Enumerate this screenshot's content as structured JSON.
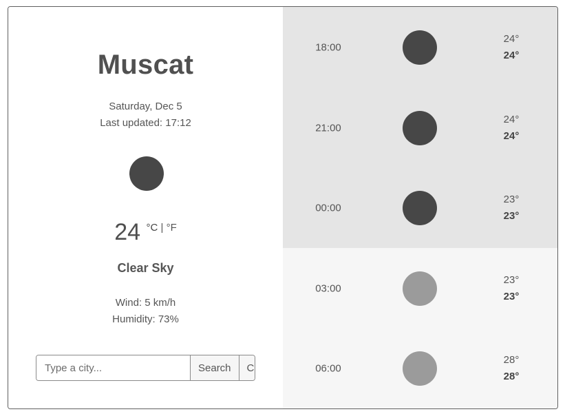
{
  "current": {
    "city": "Muscat",
    "date": "Saturday, Dec 5",
    "last_updated": "Last updated: 17:12",
    "icon": "moon-icon",
    "temperature": "24",
    "unit_celsius": "°C",
    "unit_separator": "|",
    "unit_fahrenheit": "°F",
    "description": "Clear Sky",
    "wind": "Wind: 5 km/h",
    "humidity": "Humidity: 73%"
  },
  "search": {
    "placeholder": "Type a city...",
    "value": "",
    "search_label": "Search",
    "current_label": "Current"
  },
  "forecast": [
    {
      "time": "18:00",
      "icon": "moon-icon",
      "temp_top": "24°",
      "temp_bottom": "24°"
    },
    {
      "time": "21:00",
      "icon": "moon-icon",
      "temp_top": "24°",
      "temp_bottom": "24°"
    },
    {
      "time": "00:00",
      "icon": "moon-icon",
      "temp_top": "23°",
      "temp_bottom": "23°"
    },
    {
      "time": "03:00",
      "icon": "sun-icon",
      "temp_top": "23°",
      "temp_bottom": "23°"
    },
    {
      "time": "06:00",
      "icon": "sun-icon",
      "temp_top": "28°",
      "temp_bottom": "28°"
    }
  ],
  "colors": {
    "night_icon": "#474747",
    "day_icon": "#9b9b9b",
    "night_row_bg": "#e5e5e5",
    "day_row_bg": "#f6f6f6"
  }
}
